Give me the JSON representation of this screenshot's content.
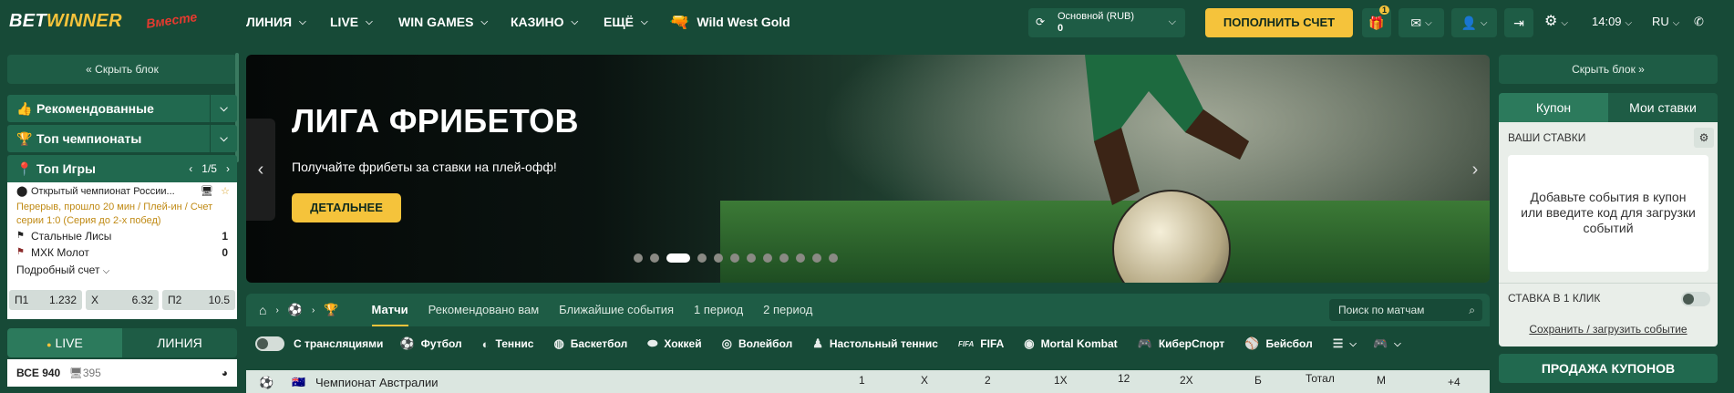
{
  "header": {
    "logo_a": "BET",
    "logo_b": "WINNER",
    "logo_badge": "Вместе",
    "nav": [
      {
        "label": "ЛИНИЯ"
      },
      {
        "label": "LIVE"
      },
      {
        "label": "WIN GAMES"
      },
      {
        "label": "КАЗИНО"
      },
      {
        "label": "ЕЩЁ"
      }
    ],
    "promo": "Wild West Gold",
    "account_type": "Основной (RUB)",
    "balance": "0",
    "deposit": "ПОПОЛНИТЬ СЧЕТ",
    "gift_count": "1",
    "time": "14:09",
    "lang": "RU"
  },
  "left": {
    "hide": "Скрыть блок",
    "recommended": "Рекомендованные",
    "top_champ": "Топ чемпионаты",
    "top_games": "Топ Игры",
    "pager": "1/5",
    "match": {
      "league": "Открытый чемпионат России...",
      "status": "Перерыв, прошло 20 мин / Плей-ин / Счет серии 1:0 (Серия до 2-х побед)",
      "team1": "Стальные Лисы",
      "score1": "1",
      "team2": "МХК Молот",
      "score2": "0",
      "detail": "Подробный счет"
    },
    "odds": [
      {
        "k": "П1",
        "v": "1.232"
      },
      {
        "k": "X",
        "v": "6.32"
      },
      {
        "k": "П2",
        "v": "10.5"
      }
    ],
    "live": "LIVE",
    "line": "ЛИНИЯ",
    "all_label": "ВСЕ 940",
    "all_count": "395"
  },
  "banner": {
    "title": "ЛИГА ФРИБЕТОВ",
    "subtitle": "Получайте фрибеты за ставки на плей-офф!",
    "button": "ДЕТАЛЬНЕЕ",
    "dot_count": 12,
    "active_dot": 3
  },
  "tabs": [
    "Матчи",
    "Рекомендовано вам",
    "Ближайшие события",
    "1 период",
    "2 период"
  ],
  "search_placeholder": "Поиск по матчам",
  "streams": "С трансляциями",
  "sports": [
    {
      "icon": "soccer-icon",
      "label": "Футбол"
    },
    {
      "icon": "tennis-icon",
      "label": "Теннис"
    },
    {
      "icon": "basketball-icon",
      "label": "Баскетбол"
    },
    {
      "icon": "hockey-icon",
      "label": "Хоккей"
    },
    {
      "icon": "volleyball-icon",
      "label": "Волейбол"
    },
    {
      "icon": "table-tennis-icon",
      "label": "Настольный теннис"
    },
    {
      "icon": "fifa-icon",
      "label": "FIFA"
    },
    {
      "icon": "mortal-kombat-icon",
      "label": "Mortal Kombat"
    },
    {
      "icon": "cybersport-icon",
      "label": "КиберСпорт"
    },
    {
      "icon": "baseball-icon",
      "label": "Бейсбол"
    }
  ],
  "fifa_tag": "FIFA",
  "championship": {
    "name": "Чемпионат Австралии",
    "cols": [
      "1",
      "X",
      "2",
      "1X",
      "12",
      "2X",
      "Б",
      "Тотал",
      "М"
    ],
    "more": "+4"
  },
  "right": {
    "hide": "Скрыть блок",
    "coupon": "Купон",
    "my_bets": "Мои ставки",
    "your_bets": "ВАШИ СТАВКИ",
    "empty": "Добавьте события в купон или введите код для загрузки событий",
    "one_click": "СТАВКА В 1 КЛИК",
    "save_load": "Сохранить / загрузить событие",
    "sale": "ПРОДАЖА КУПОНОВ"
  },
  "colors": {
    "bg": "#174a37",
    "accent": "#f5c33b",
    "panel": "#1e5c45"
  }
}
